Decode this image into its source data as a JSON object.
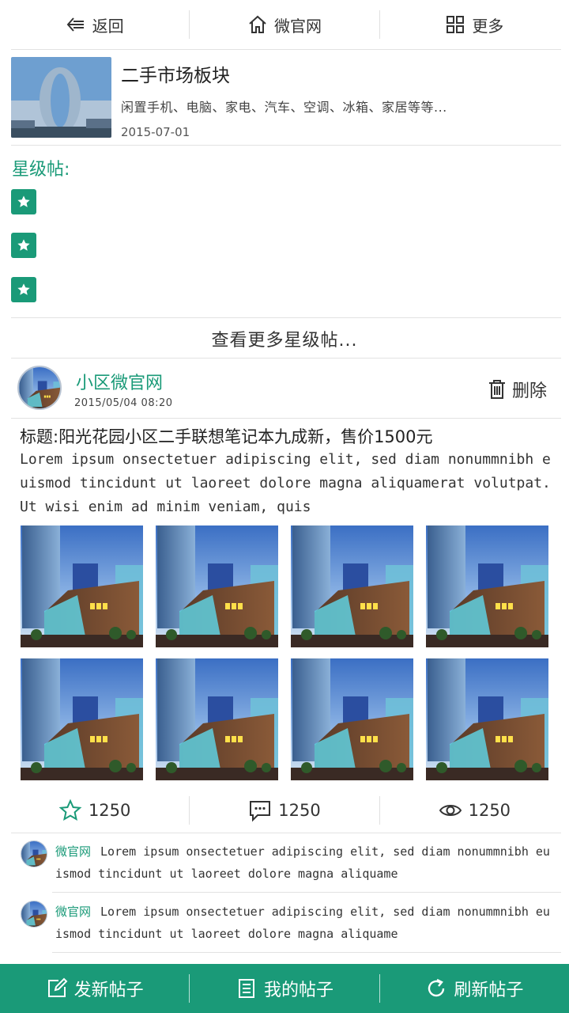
{
  "colors": {
    "accent": "#1a9a78",
    "text": "#333333",
    "divider": "#e2e2e2"
  },
  "topnav": {
    "back_label": "返回",
    "home_label": "微官网",
    "more_label": "更多"
  },
  "board": {
    "title": "二手市场板块",
    "description": "闲置手机、电脑、家电、汽车、空调、冰箱、家居等等...",
    "date": "2015-07-01"
  },
  "stars": {
    "heading": "星级帖:",
    "more_label": "查看更多星级帖..."
  },
  "post": {
    "author": "小区微官网",
    "time": "2015/05/04  08:20",
    "delete_label": "删除",
    "title": "标题:阳光花园小区二手联想笔记本九成新，售价1500元",
    "body": "Lorem ipsum onsectetuer adipiscing elit, sed diam nonummnibh  euismod tincidunt ut laoreet dolore magna aliquamerat volutpat. Ut wisi enim ad minim veniam, quis",
    "stats": {
      "favorites": "1250",
      "comments": "1250",
      "views": "1250"
    }
  },
  "comments": [
    {
      "author": "微官网",
      "text": "Lorem ipsum onsectetuer adipiscing elit, sed diam nonummnibh  euismod tincidunt ut laoreet dolore magna aliquame"
    },
    {
      "author": "微官网",
      "text": "Lorem ipsum onsectetuer adipiscing elit, sed diam nonummnibh  euismod tincidunt ut laoreet dolore magna aliquame"
    }
  ],
  "bottombar": {
    "new_post_label": "发新帖子",
    "my_posts_label": "我的帖子",
    "refresh_label": "刷新帖子"
  }
}
